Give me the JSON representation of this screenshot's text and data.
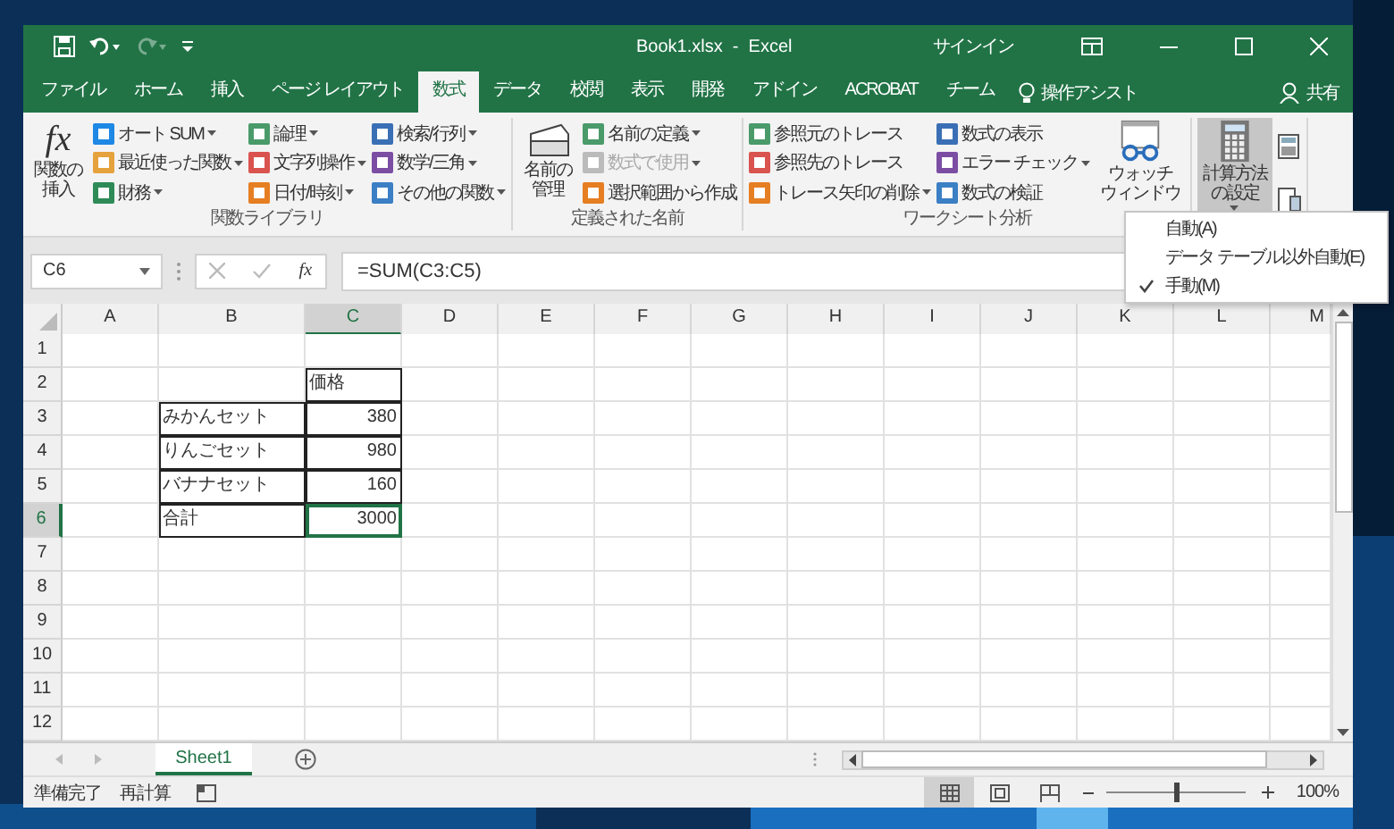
{
  "window": {
    "title": "Book1.xlsx  -  Excel",
    "signin": "サインイン"
  },
  "quick_access": {
    "redo_disabled": true
  },
  "tabs": [
    {
      "label": "ファイル",
      "selected": false
    },
    {
      "label": "ホーム",
      "selected": false
    },
    {
      "label": "挿入",
      "selected": false
    },
    {
      "label": "ページ レイアウト",
      "selected": false
    },
    {
      "label": "数式",
      "selected": true
    },
    {
      "label": "データ",
      "selected": false
    },
    {
      "label": "校閲",
      "selected": false
    },
    {
      "label": "表示",
      "selected": false
    },
    {
      "label": "開発",
      "selected": false
    },
    {
      "label": "アドイン",
      "selected": false
    },
    {
      "label": "ACROBAT",
      "selected": false
    },
    {
      "label": "チーム",
      "selected": false
    }
  ],
  "tell_me": "操作アシスト",
  "share": "共有",
  "ribbon": [
    {
      "label": "関数ライブラリ",
      "controls": [
        {
          "kind": "large",
          "label": "関数の挿入",
          "glyph": "fx",
          "menu": false,
          "pressed": false
        },
        {
          "kind": "column",
          "items": [
            {
              "label": "オート SUM",
              "menu": true,
              "disabled": false
            },
            {
              "label": "最近使った関数",
              "menu": true,
              "disabled": false
            },
            {
              "label": "財務",
              "menu": true,
              "disabled": false
            }
          ]
        },
        {
          "kind": "column",
          "items": [
            {
              "label": "論理",
              "menu": true,
              "disabled": false
            },
            {
              "label": "文字列操作",
              "menu": true,
              "disabled": false
            },
            {
              "label": "日付/時刻",
              "menu": true,
              "disabled": false
            }
          ]
        },
        {
          "kind": "column",
          "items": [
            {
              "label": "検索/行列",
              "menu": true,
              "disabled": false
            },
            {
              "label": "数学/三角",
              "menu": true,
              "disabled": false
            },
            {
              "label": "その他の関数",
              "menu": true,
              "disabled": false
            }
          ]
        }
      ]
    },
    {
      "label": "定義された名前",
      "controls": [
        {
          "kind": "large",
          "label": "名前の管理",
          "menu": false,
          "pressed": false
        },
        {
          "kind": "column",
          "items": [
            {
              "label": "名前の定義",
              "menu": true,
              "disabled": false
            },
            {
              "label": "数式で使用",
              "menu": true,
              "disabled": true
            },
            {
              "label": "選択範囲から作成",
              "menu": false,
              "disabled": false
            }
          ]
        }
      ]
    },
    {
      "label": "ワークシート分析",
      "controls": [
        {
          "kind": "column",
          "items": [
            {
              "label": "参照元のトレース",
              "menu": false,
              "disabled": false
            },
            {
              "label": "参照先のトレース",
              "menu": false,
              "disabled": false
            },
            {
              "label": "トレース矢印の削除",
              "menu": true,
              "disabled": false
            }
          ]
        },
        {
          "kind": "column",
          "items": [
            {
              "label": "数式の表示",
              "menu": false,
              "disabled": false
            },
            {
              "label": "エラー チェック",
              "menu": true,
              "disabled": false
            },
            {
              "label": "数式の検証",
              "menu": false,
              "disabled": false
            }
          ]
        },
        {
          "kind": "large",
          "label": "ウォッチウィンドウ",
          "menu": false,
          "pressed": false
        }
      ]
    },
    {
      "controls": [
        {
          "kind": "large",
          "label": "計算方法の設定",
          "menu": true,
          "pressed": true
        },
        {
          "kind": "icons"
        }
      ]
    }
  ],
  "calc_menu": [
    {
      "label": "自動(A)",
      "checked": false
    },
    {
      "label": "データ テーブル以外自動(E)",
      "checked": false
    },
    {
      "label": "手動(M)",
      "checked": true
    }
  ],
  "name_box": "C6",
  "function_button": "fx",
  "formula": "=SUM(C3:C5)",
  "columns": [
    {
      "label": "A",
      "selected": false
    },
    {
      "label": "B",
      "selected": false
    },
    {
      "label": "C",
      "selected": true
    },
    {
      "label": "D",
      "selected": false
    },
    {
      "label": "E",
      "selected": false
    },
    {
      "label": "F",
      "selected": false
    },
    {
      "label": "G",
      "selected": false
    },
    {
      "label": "H",
      "selected": false
    },
    {
      "label": "I",
      "selected": false
    },
    {
      "label": "J",
      "selected": false
    },
    {
      "label": "K",
      "selected": false
    },
    {
      "label": "L",
      "selected": false
    },
    {
      "label": "M",
      "selected": false
    }
  ],
  "rows": [
    {
      "label": "1",
      "selected": false
    },
    {
      "label": "2",
      "selected": false,
      "cells": [
        null,
        null,
        {
          "text": "価格",
          "kind": "text",
          "bordered": true,
          "active": false
        }
      ]
    },
    {
      "label": "3",
      "selected": false,
      "cells": [
        null,
        {
          "text": "みかんセット",
          "kind": "text",
          "bordered": true,
          "active": false
        },
        {
          "text": "380",
          "kind": "number",
          "bordered": true,
          "active": false
        }
      ]
    },
    {
      "label": "4",
      "selected": false,
      "cells": [
        null,
        {
          "text": "りんごセット",
          "kind": "text",
          "bordered": true,
          "active": false
        },
        {
          "text": "980",
          "kind": "number",
          "bordered": true,
          "active": false
        }
      ]
    },
    {
      "label": "5",
      "selected": false,
      "cells": [
        null,
        {
          "text": "バナナセット",
          "kind": "text",
          "bordered": true,
          "active": false
        },
        {
          "text": "160",
          "kind": "number",
          "bordered": true,
          "active": false
        }
      ]
    },
    {
      "label": "6",
      "selected": true,
      "cells": [
        null,
        {
          "text": "合計",
          "kind": "text",
          "bordered": true,
          "active": false
        },
        {
          "text": "3000",
          "kind": "number",
          "bordered": true,
          "active": true
        }
      ]
    },
    {
      "label": "7",
      "selected": false
    },
    {
      "label": "8",
      "selected": false
    },
    {
      "label": "9",
      "selected": false
    },
    {
      "label": "10",
      "selected": false
    },
    {
      "label": "11",
      "selected": false
    },
    {
      "label": "12",
      "selected": false
    }
  ],
  "sheets": [
    {
      "label": "Sheet1",
      "selected": true
    }
  ],
  "status": {
    "ready": "準備完了",
    "recalc": "再計算",
    "zoom": "100%",
    "zoom_level": {
      "level": 0.5
    }
  },
  "views": [
    {
      "selected": true
    },
    {
      "selected": false
    },
    {
      "selected": false
    }
  ]
}
